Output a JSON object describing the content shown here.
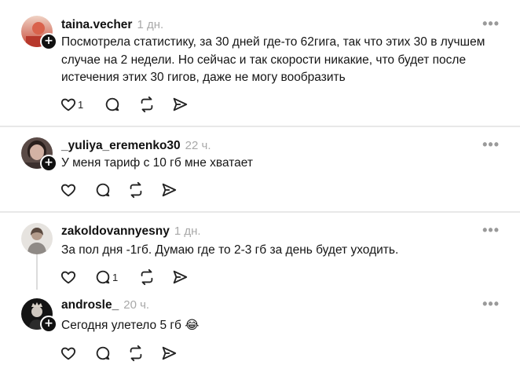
{
  "posts": [
    {
      "username": "taina.vecher",
      "time": "1 дн.",
      "text": "Посмотрела статистику, за 30 дней где-то 62гига, так что этих 30 в лучшем случае на 2 недели. Но сейчас и так скорости никакие, что будет после истечения этих 30 гигов, даже не могу вообразить",
      "like_count": "1",
      "reply_count": "",
      "more": "•••"
    },
    {
      "username": "_yuliya_eremenko30",
      "time": "22 ч.",
      "text": "У меня тариф с 10 гб мне хватает",
      "like_count": "",
      "reply_count": "",
      "more": "•••"
    },
    {
      "username": "zakoldovannyesny",
      "time": "1 дн.",
      "text": "За пол дня -1гб. Думаю где то 2-3 гб за день будет уходить.",
      "like_count": "",
      "reply_count": "1",
      "more": "•••"
    },
    {
      "username": "androsle_",
      "time": "20 ч.",
      "text": "Сегодня улетело 5 гб 😂",
      "like_count": "",
      "reply_count": "",
      "more": "•••"
    }
  ],
  "badge": "+",
  "icons": [
    "heart-icon",
    "comment-icon",
    "repost-icon",
    "share-icon",
    "plus-icon",
    "more-icon"
  ],
  "colors": {
    "text": "#151515",
    "time": "#a9a9a9",
    "divider": "#e8e8e8",
    "badge": "#111111"
  }
}
